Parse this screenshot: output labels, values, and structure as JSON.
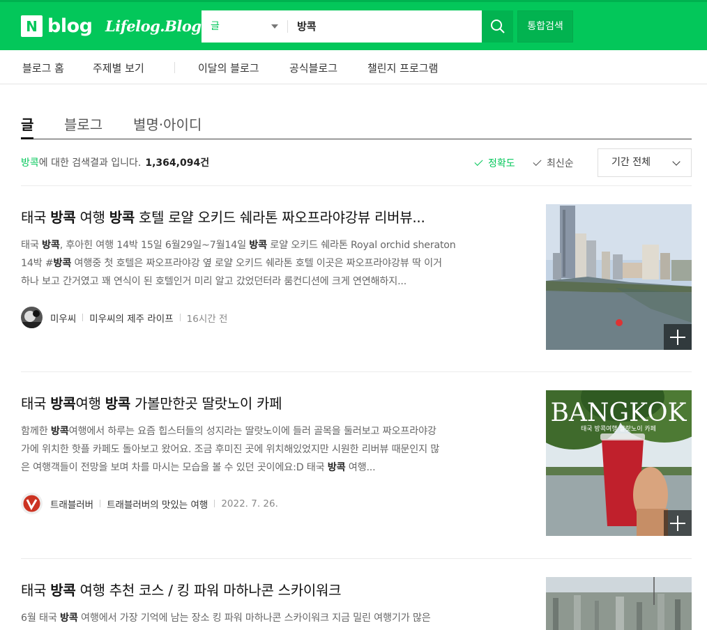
{
  "header": {
    "logo_n": "N",
    "logo_word": "blog",
    "lifelog": "Lifelog.Blog",
    "search_scope": "글",
    "search_query": "방콕",
    "integrated_label": "통합검색",
    "brand_color": "#03c75a"
  },
  "nav": {
    "items": [
      "블로그 홈",
      "주제별 보기",
      "이달의 블로그",
      "공식블로그",
      "챌린지 프로그램"
    ]
  },
  "tabs": [
    "글",
    "블로그",
    "별명·아이디"
  ],
  "summary": {
    "keyword": "방콕",
    "text": "에 대한 검색결과 입니다.",
    "count": "1,364,094건"
  },
  "sort": {
    "accuracy": "정확도",
    "latest": "최신순",
    "period": "기간 전체"
  },
  "posts": [
    {
      "title_parts": [
        "태국 ",
        "방콕",
        " 여행 ",
        "방콕",
        " 호텔 로얄 오키드 쉐라톤 짜오프라야강뷰 리버뷰..."
      ],
      "desc_lines": [
        [
          "태국 ",
          "방콕",
          ", 후아힌 여행 14박 15일 6월29일~7월14일 ",
          "방콕",
          " 로얄 오키드 쉐라톤 Royal orchid sheraton"
        ],
        [
          "14박 #",
          "방콕",
          " 여행중 첫 호텔은 짜오프라야강 옆 로얄 오키드 쉐라톤 호텔 이곳은 짜오프라야강뷰 딱 이거"
        ],
        [
          "하나 보고 간거였고 꽤 연식이 된 호텔인거 미리 알고 갔었던터라 룸컨디션에 크게 연연해하지..."
        ]
      ],
      "author": "미우씨",
      "blog": "미우씨의 제주 라이프",
      "time": "16시간 전"
    },
    {
      "title_parts": [
        "태국 ",
        "방콕",
        "여행 ",
        "방콕",
        " 가볼만한곳 딸랏노이 카페"
      ],
      "desc_lines": [
        [
          "함께한 ",
          "방콕",
          "여행에서 하루는 요즘 힙스터들의 성지라는 딸랏노이에 들러 골목을 둘러보고 짜오프라야강"
        ],
        [
          "가에 위치한 핫플 카페도 돌아보고 왔어요. 조금 후미진 곳에 위치해있었지만 시원한 리버뷰 때문인지 많"
        ],
        [
          "은 여행객들이 전망을 보며 차를 마시는 모습을 볼 수 있던 곳이에요:D 태국 ",
          "방콕",
          " 여행..."
        ]
      ],
      "author": "트래블러버",
      "blog": "트래블러버의 맛있는 여행",
      "time": "2022. 7. 26.",
      "thumb_text": "BANGKOK",
      "thumb_sub": "태국 방콕여행 딸랏노이 카페"
    },
    {
      "title_parts": [
        "태국 ",
        "방콕",
        " 여행 추천 코스 / 킹 파워 마하나콘 스카이워크"
      ],
      "desc_lines": [
        [
          "6월 태국 ",
          "방콕",
          " 여행에서 가장 기억에 남는 장소 킹 파워 마하나콘 스카이워크 지금 밀린 여행기가 많은"
        ]
      ]
    }
  ]
}
